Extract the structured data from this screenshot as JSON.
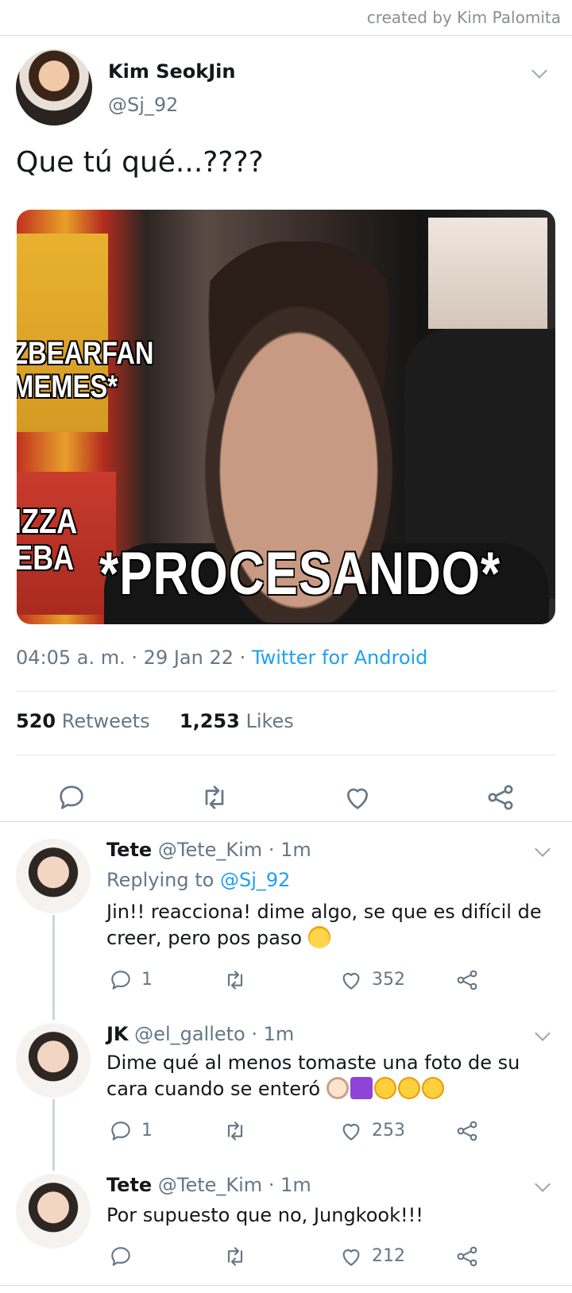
{
  "credit": "created by Kim Palomita",
  "tweet": {
    "name": "Kim SeokJin",
    "handle": "@Sj_92",
    "text": "Que tú qué...????",
    "image_text": {
      "top_left": "ZBEARFAN\nMEMES*",
      "bottom_left": "IZZA\nEBA",
      "main": "*PROCESANDO*"
    },
    "time": "04:05 a. m.",
    "date": "29 Jan 22",
    "source": "Twitter for Android",
    "retweets_count": "520",
    "retweets_label": "Retweets",
    "likes_count": "1,253",
    "likes_label": "Likes",
    "icons": [
      "reply-icon",
      "retweet-icon",
      "like-icon",
      "share-icon"
    ]
  },
  "replies": [
    {
      "name": "Tete",
      "handle": "@Tete_Kim",
      "time": "1m",
      "replying_label": "Replying to",
      "replying_to": "@Sj_92",
      "text": "Jin!! reacciona! dime algo, se que es difícil de creer, pero pos paso",
      "emojis": [
        "sweat-smile"
      ],
      "reply_count": "1",
      "retweet_count": "",
      "like_count": "352"
    },
    {
      "name": "JK",
      "handle": "@el_galleto",
      "time": "1m",
      "text": "Dime qué al menos tomaste una foto de su cara cuando se enteró",
      "emojis": [
        "ok-hand",
        "elevator-sign",
        "rofl",
        "rofl",
        "rofl"
      ],
      "reply_count": "1",
      "retweet_count": "",
      "like_count": "253"
    },
    {
      "name": "Tete",
      "handle": "@Tete_Kim",
      "time": "1m",
      "text": "Por supuesto que no, Jungkook!!!",
      "emojis": [],
      "reply_count": "",
      "retweet_count": "",
      "like_count": "212"
    }
  ],
  "colors": {
    "link": "#1da1f2",
    "secondary_text": "#657786",
    "primary_text": "#14171a",
    "divider": "#e1e8ed"
  }
}
